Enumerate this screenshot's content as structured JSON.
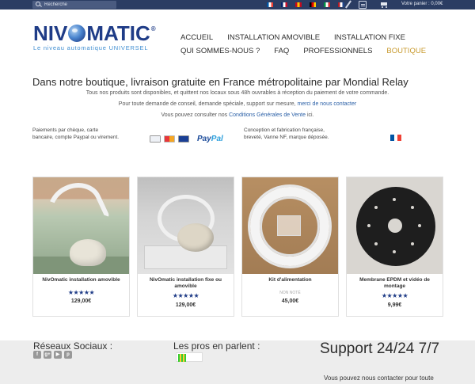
{
  "topbar": {
    "search_placeholder": "Recherche",
    "flags": [
      {
        "name": "flag-fr-icon",
        "colors": [
          "#0055a4",
          "#ffffff",
          "#ef4135"
        ]
      },
      {
        "name": "flag-uk-icon",
        "colors": [
          "#012169",
          "#ffffff",
          "#c8102e"
        ]
      },
      {
        "name": "flag-es-icon",
        "colors": [
          "#c60b1e",
          "#ffc400",
          "#c60b1e"
        ]
      },
      {
        "name": "flag-de-icon",
        "colors": [
          "#000000",
          "#dd0000",
          "#ffce00"
        ]
      },
      {
        "name": "flag-it-icon",
        "colors": [
          "#009246",
          "#ffffff",
          "#ce2b37"
        ]
      },
      {
        "name": "flag-nl-icon",
        "colors": [
          "#ae1c28",
          "#ffffff",
          "#21468b"
        ]
      }
    ],
    "cart_text": "Votre panier : 0,00€"
  },
  "logo": {
    "part1": "NIV",
    "part2": "MATIC",
    "reg": "®",
    "tagline": "Le niveau automatique UNIVERSEL"
  },
  "nav": {
    "row1": [
      "ACCUEIL",
      "INSTALLATION AMOVIBLE",
      "INSTALLATION FIXE"
    ],
    "row2": [
      "QUI SOMMES-NOUS ?",
      "FAQ",
      "PROFESSIONNELS",
      "BOUTIQUE"
    ],
    "active": "BOUTIQUE",
    "active_color": "#c89a2e"
  },
  "intro": {
    "headline": "Dans notre boutique, livraison gratuite en France métropolitaine par Mondial Relay",
    "line1": "Tous nos produits sont disponibles, et quittent nos locaux sous 48h ouvrables à réception du paiement de votre commande.",
    "line2_text": "Pour toute demande de conseil, demande spéciale, support sur mesure, ",
    "line2_link": "merci de nous contacter",
    "line3_text": "Vous pouvez consulter nos ",
    "line3_link": "Conditions Générales de Vente",
    "line3_end": " ici."
  },
  "info": {
    "payment_text": "Paiements par chèque, carte bancaire, compte Paypal ou virement.",
    "paypal_part1": "Pay",
    "paypal_part2": "Pal",
    "conception_text": "Conception et fabrication française, breveté, Vanne NF, marque déposée."
  },
  "products": [
    {
      "name": "NivOmatic installation amovible",
      "rating": "★★★★★",
      "note": "",
      "price": "129,00€"
    },
    {
      "name": "NivOmatic installation fixe ou amovible",
      "rating": "★★★★★",
      "note": "",
      "price": "129,00€"
    },
    {
      "name": "Kit d'alimentation",
      "rating": "",
      "note": "NON NOTÉ",
      "price": "45,00€"
    },
    {
      "name": "Membrane EPDM et vidéo de montage",
      "rating": "★★★★★",
      "note": "",
      "price": "9,99€"
    }
  ],
  "footer": {
    "social_title": "Réseaux Sociaux :",
    "social_icons": [
      "f",
      "g+",
      "▶",
      "p"
    ],
    "pros_title": "Les pros en parlent :",
    "support_title": "Support 24/24 7/7",
    "support_sub": "Vous pouvez nous contacter pour toute"
  }
}
